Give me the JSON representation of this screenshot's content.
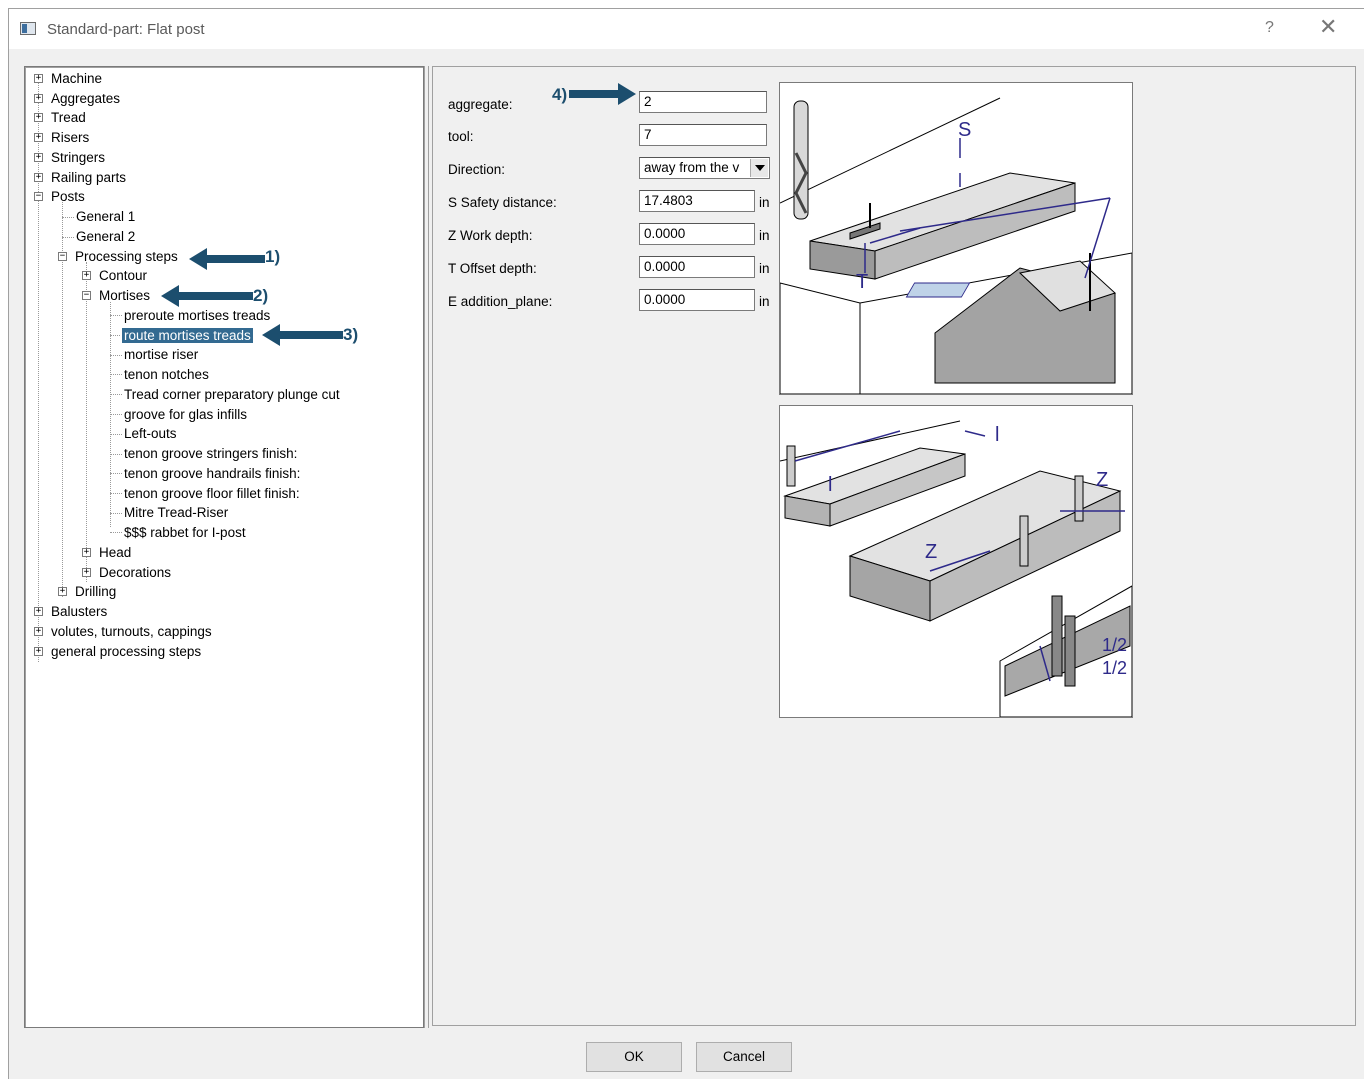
{
  "window": {
    "title": "Standard-part: Flat post",
    "help": "?",
    "close": "✕"
  },
  "tree": {
    "machine": "Machine",
    "aggregates": "Aggregates",
    "tread": "Tread",
    "risers": "Risers",
    "stringers": "Stringers",
    "railing_parts": "Railing parts",
    "posts": "Posts",
    "general1": "General  1",
    "general2": "General  2",
    "processing_steps": "Processing steps",
    "contour": "Contour",
    "mortises": "Mortises",
    "preroute": "preroute mortises treads",
    "route": "route mortises treads",
    "mortise_riser": "mortise riser",
    "tenon_notches": "tenon notches",
    "tread_corner": "Tread corner preparatory plunge cut",
    "groove_glas": "groove for glas infills",
    "left_outs": "Left-outs",
    "tenon_stringers": "tenon groove stringers finish:",
    "tenon_handrails": "tenon groove handrails finish:",
    "tenon_floor": "tenon groove floor fillet finish:",
    "mitre": "Mitre Tread-Riser",
    "rabbet": "$$$ rabbet for I-post",
    "head": "Head",
    "decorations": "Decorations",
    "drilling": "Drilling",
    "balusters": "Balusters",
    "volutes": "volutes, turnouts, cappings",
    "general_steps": "general processing steps"
  },
  "form": {
    "aggregate_label": "aggregate:",
    "aggregate_value": "2",
    "tool_label": "tool:",
    "tool_value": "7",
    "direction_label": "Direction:",
    "direction_value": "away from the v",
    "safety_label": "S  Safety distance:",
    "safety_value": "17.4803",
    "work_label": "Z  Work depth:",
    "work_value": "0.0000",
    "offset_label": "T  Offset depth:",
    "offset_value": "0.0000",
    "addition_label": "E  addition_plane:",
    "addition_value": "0.0000",
    "unit": "in"
  },
  "figure1": {
    "s": "S",
    "t": "T"
  },
  "figure2": {
    "l": "l",
    "z": "Z",
    "half": "1/2"
  },
  "callouts": {
    "c1": "1)",
    "c2": "2)",
    "c3": "3)",
    "c4": "4)"
  },
  "buttons": {
    "ok": "OK",
    "cancel": "Cancel"
  },
  "colors": {
    "selection": "#336a91",
    "callout_arrow": "#1c4e6e",
    "dimension_blue": "#2e2a8a"
  }
}
